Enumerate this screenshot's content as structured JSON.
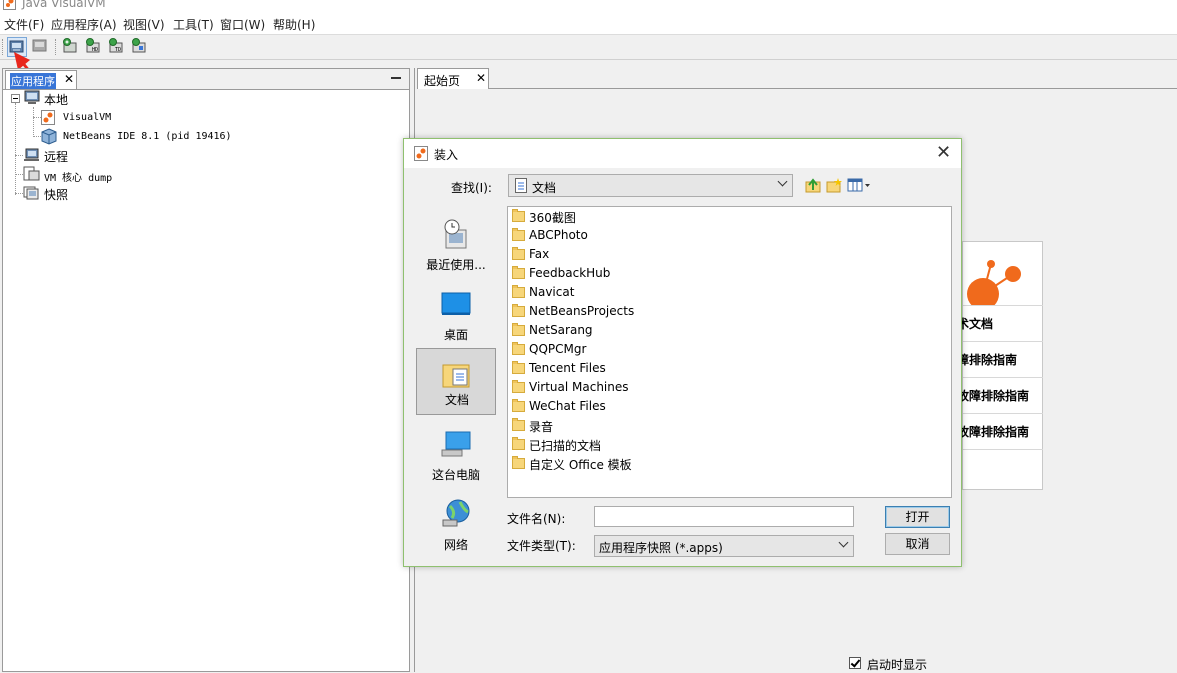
{
  "window": {
    "title": "Java VisualVM"
  },
  "menubar": {
    "items": [
      "文件(F)",
      "应用程序(A)",
      "视图(V)",
      "工具(T)",
      "窗口(W)",
      "帮助(H)"
    ]
  },
  "left_panel": {
    "tab_label": "应用程序",
    "close": "✕",
    "tree": {
      "local": "本地",
      "visualvm": "VisualVM",
      "netbeans": "NetBeans IDE 8.1 (pid 19416)",
      "remote": "远程",
      "coredump": "VM 核心 dump",
      "snapshots": "快照"
    }
  },
  "right_panel": {
    "tab_label": "起始页",
    "close": "✕",
    "card_links": [
      "术文档",
      "障排除指南",
      "故障排除指南",
      "故障排除指南"
    ],
    "show_on_startup": "启动时显示"
  },
  "dialog": {
    "title": "装入",
    "close": "✕",
    "look_in_label": "查找(I):",
    "look_in_value": "文档",
    "places": [
      "最近使用...",
      "桌面",
      "文档",
      "这台电脑",
      "网络"
    ],
    "selected_place": "文档",
    "files": [
      "360截图",
      "ABCPhoto",
      "Fax",
      "FeedbackHub",
      "Navicat",
      "NetBeansProjects",
      "NetSarang",
      "QQPCMgr",
      "Tencent Files",
      "Virtual Machines",
      "WeChat Files",
      "录音",
      "已扫描的文档",
      "自定义 Office 模板"
    ],
    "filename_label": "文件名(N):",
    "filename_value": "",
    "filetype_label": "文件类型(T):",
    "filetype_value": "应用程序快照 (*.apps)",
    "open_button": "打开",
    "cancel_button": "取消"
  },
  "colors": {
    "accent": "#3875d7",
    "dialog_border": "#8fc06f",
    "annotation_arrow": "#e8261c"
  }
}
